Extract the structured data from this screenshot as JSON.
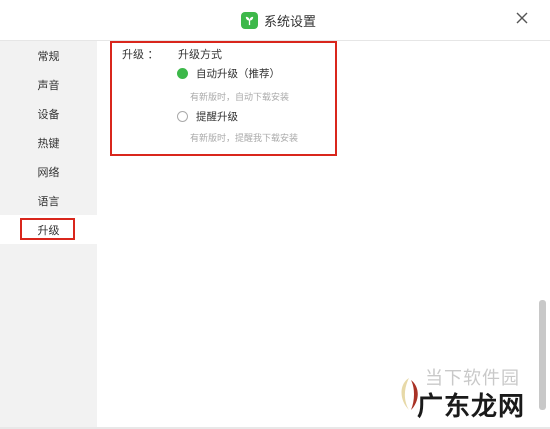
{
  "window": {
    "title": "系统设置"
  },
  "sidebar": {
    "items": [
      {
        "label": "常规"
      },
      {
        "label": "声音"
      },
      {
        "label": "设备"
      },
      {
        "label": "热键"
      },
      {
        "label": "网络"
      },
      {
        "label": "语言"
      },
      {
        "label": "升级",
        "active": true
      }
    ]
  },
  "upgrade": {
    "section_label": "升级 ：",
    "method_label": "升级方式",
    "options": [
      {
        "label": "自动升级（推荐）",
        "hint": "有新版时，自动下载安装",
        "checked": true
      },
      {
        "label": "提醒升级",
        "hint": "有新版时，提醒我下载安装",
        "checked": false
      }
    ]
  },
  "watermark": {
    "top_text": "当下软件园",
    "main_text": "广东龙网"
  },
  "colors": {
    "accent": "#3db84a",
    "highlight": "#d9261c"
  },
  "icons": {
    "app": "sprout-icon",
    "close": "close-icon"
  }
}
